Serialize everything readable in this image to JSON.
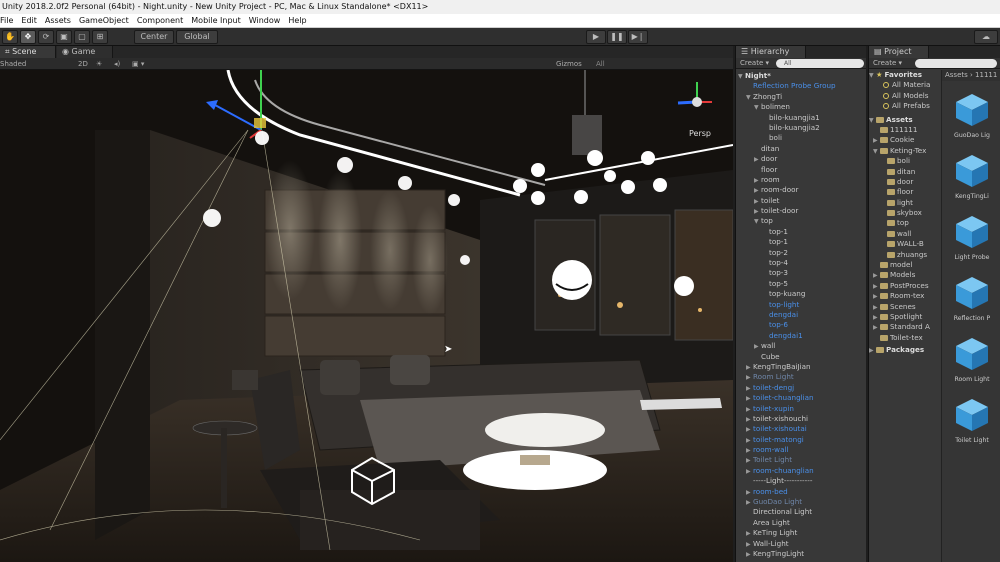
{
  "window": {
    "title": "Unity 2018.2.0f2 Personal (64bit) - Night.unity - New Unity Project - PC, Mac & Linux Standalone* <DX11>"
  },
  "menu": [
    "File",
    "Edit",
    "Assets",
    "GameObject",
    "Component",
    "Mobile Input",
    "Window",
    "Help"
  ],
  "toolbar": {
    "pivot": "Center",
    "space": "Global"
  },
  "scene": {
    "tabs": [
      "Scene",
      "Game"
    ],
    "shading": "Shaded",
    "mode_2d": "2D",
    "gizmos": "Gizmos",
    "search": "All",
    "persp": "Persp"
  },
  "hierarchy": {
    "tab": "Hierarchy",
    "create": "Create",
    "search": "All",
    "items": [
      {
        "label": "Night*",
        "depth": 0,
        "style": "bold",
        "arrow": "▼"
      },
      {
        "label": "Reflection Probe Group",
        "depth": 1,
        "style": "blue",
        "arrow": ""
      },
      {
        "label": "ZhongTi",
        "depth": 1,
        "style": "",
        "arrow": "▼"
      },
      {
        "label": "bolimen",
        "depth": 2,
        "style": "",
        "arrow": "▼"
      },
      {
        "label": "bilo-kuangjia1",
        "depth": 3,
        "style": "",
        "arrow": ""
      },
      {
        "label": "bilo-kuangjia2",
        "depth": 3,
        "style": "",
        "arrow": ""
      },
      {
        "label": "boli",
        "depth": 3,
        "style": "",
        "arrow": ""
      },
      {
        "label": "ditan",
        "depth": 2,
        "style": "",
        "arrow": ""
      },
      {
        "label": "door",
        "depth": 2,
        "style": "",
        "arrow": "▶"
      },
      {
        "label": "floor",
        "depth": 2,
        "style": "",
        "arrow": ""
      },
      {
        "label": "room",
        "depth": 2,
        "style": "",
        "arrow": "▶"
      },
      {
        "label": "room-door",
        "depth": 2,
        "style": "",
        "arrow": "▶"
      },
      {
        "label": "toilet",
        "depth": 2,
        "style": "",
        "arrow": "▶"
      },
      {
        "label": "toilet-door",
        "depth": 2,
        "style": "",
        "arrow": "▶"
      },
      {
        "label": "top",
        "depth": 2,
        "style": "",
        "arrow": "▼"
      },
      {
        "label": "top-1",
        "depth": 3,
        "style": "",
        "arrow": ""
      },
      {
        "label": "top-1",
        "depth": 3,
        "style": "",
        "arrow": ""
      },
      {
        "label": "top-2",
        "depth": 3,
        "style": "",
        "arrow": ""
      },
      {
        "label": "top-4",
        "depth": 3,
        "style": "",
        "arrow": ""
      },
      {
        "label": "top-3",
        "depth": 3,
        "style": "",
        "arrow": ""
      },
      {
        "label": "top-5",
        "depth": 3,
        "style": "",
        "arrow": ""
      },
      {
        "label": "top-kuang",
        "depth": 3,
        "style": "",
        "arrow": ""
      },
      {
        "label": "top-light",
        "depth": 3,
        "style": "blue",
        "arrow": ""
      },
      {
        "label": "dengdai",
        "depth": 3,
        "style": "blue",
        "arrow": ""
      },
      {
        "label": "top-6",
        "depth": 3,
        "style": "blue",
        "arrow": ""
      },
      {
        "label": "dengdai1",
        "depth": 3,
        "style": "blue",
        "arrow": ""
      },
      {
        "label": "wall",
        "depth": 2,
        "style": "",
        "arrow": "▶"
      },
      {
        "label": "Cube",
        "depth": 2,
        "style": "",
        "arrow": ""
      },
      {
        "label": "KengTingBaiJian",
        "depth": 1,
        "style": "",
        "arrow": "▶"
      },
      {
        "label": "Room Light",
        "depth": 1,
        "style": "faded",
        "arrow": "▶"
      },
      {
        "label": "toilet-dengj",
        "depth": 1,
        "style": "blue",
        "arrow": "▶"
      },
      {
        "label": "toilet-chuanglian",
        "depth": 1,
        "style": "blue",
        "arrow": "▶"
      },
      {
        "label": "toilet-xupin",
        "depth": 1,
        "style": "blue",
        "arrow": "▶"
      },
      {
        "label": "toilet-xishouchi",
        "depth": 1,
        "style": "",
        "arrow": "▶"
      },
      {
        "label": "toilet-xishoutai",
        "depth": 1,
        "style": "blue",
        "arrow": "▶"
      },
      {
        "label": "toilet-matongi",
        "depth": 1,
        "style": "blue",
        "arrow": "▶"
      },
      {
        "label": "room-wall",
        "depth": 1,
        "style": "blue",
        "arrow": "▶"
      },
      {
        "label": "Toilet Light",
        "depth": 1,
        "style": "faded",
        "arrow": "▶"
      },
      {
        "label": "room-chuanglian",
        "depth": 1,
        "style": "blue",
        "arrow": "▶"
      },
      {
        "label": "-----Light-----------",
        "depth": 1,
        "style": "",
        "arrow": ""
      },
      {
        "label": "room-bed",
        "depth": 1,
        "style": "blue",
        "arrow": "▶"
      },
      {
        "label": "GuoDao Light",
        "depth": 1,
        "style": "faded",
        "arrow": "▶"
      },
      {
        "label": "Directional Light",
        "depth": 1,
        "style": "",
        "arrow": ""
      },
      {
        "label": "Area Light",
        "depth": 1,
        "style": "",
        "arrow": ""
      },
      {
        "label": "KeTing Light",
        "depth": 1,
        "style": "",
        "arrow": "▶"
      },
      {
        "label": "Wall-Light",
        "depth": 1,
        "style": "",
        "arrow": "▶"
      },
      {
        "label": "KengTingLight",
        "depth": 1,
        "style": "",
        "arrow": "▶"
      }
    ]
  },
  "project": {
    "tab": "Project",
    "create": "Create",
    "favorites_label": "Favorites",
    "favorites": [
      "All Materia",
      "All Models",
      "All Prefabs"
    ],
    "assets_label": "Assets",
    "tree": [
      {
        "label": "111111",
        "depth": 1,
        "arrow": ""
      },
      {
        "label": "Cookie",
        "depth": 1,
        "arrow": "▶"
      },
      {
        "label": "Keting-Tex",
        "depth": 1,
        "arrow": "▼"
      },
      {
        "label": "boli",
        "depth": 2,
        "arrow": ""
      },
      {
        "label": "ditan",
        "depth": 2,
        "arrow": ""
      },
      {
        "label": "door",
        "depth": 2,
        "arrow": ""
      },
      {
        "label": "floor",
        "depth": 2,
        "arrow": ""
      },
      {
        "label": "light",
        "depth": 2,
        "arrow": ""
      },
      {
        "label": "skybox",
        "depth": 2,
        "arrow": ""
      },
      {
        "label": "top",
        "depth": 2,
        "arrow": ""
      },
      {
        "label": "wall",
        "depth": 2,
        "arrow": ""
      },
      {
        "label": "WALL-B",
        "depth": 2,
        "arrow": ""
      },
      {
        "label": "zhuangs",
        "depth": 2,
        "arrow": ""
      },
      {
        "label": "model",
        "depth": 1,
        "arrow": ""
      },
      {
        "label": "Models",
        "depth": 1,
        "arrow": "▶"
      },
      {
        "label": "PostProces",
        "depth": 1,
        "arrow": "▶"
      },
      {
        "label": "Room-tex",
        "depth": 1,
        "arrow": "▶"
      },
      {
        "label": "Scenes",
        "depth": 1,
        "arrow": "▶"
      },
      {
        "label": "Spotlight",
        "depth": 1,
        "arrow": "▶"
      },
      {
        "label": "Standard A",
        "depth": 1,
        "arrow": "▶"
      },
      {
        "label": "Toilet-tex",
        "depth": 1,
        "arrow": ""
      }
    ],
    "packages_label": "Packages",
    "breadcrumb": "Assets › 11111",
    "assets": [
      "GuoDao Lig",
      "KengTingLi",
      "Light Probe",
      "Reflection P",
      "Room Light",
      "Toilet Light"
    ],
    "asset_color": "#3a9ad9"
  }
}
